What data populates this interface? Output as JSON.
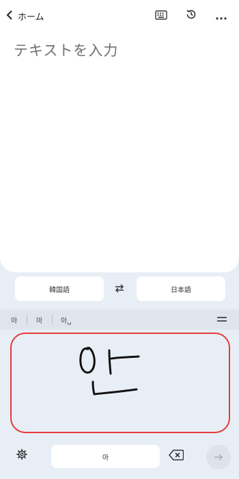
{
  "header": {
    "back_label": "ホーム",
    "icons": [
      "chevron-left-icon",
      "keyboard-icon",
      "history-icon",
      "more-icon"
    ]
  },
  "input": {
    "placeholder": "テキストを入力"
  },
  "languages": {
    "source": "韓国語",
    "target": "日本語"
  },
  "suggestions": [
    "아",
    "마",
    "아␣"
  ],
  "handwriting": {
    "strokes_description_icon": "handwriting-canvas"
  },
  "bottom": {
    "candidate": "아"
  },
  "colors": {
    "accent_border": "#e53935",
    "panel_bg": "#e8eef6",
    "card_bg": "#ffffff"
  }
}
